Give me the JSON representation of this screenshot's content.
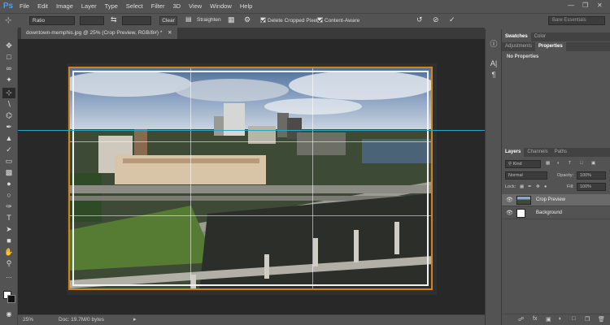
{
  "app": {
    "logo": "Ps",
    "menu": [
      "File",
      "Edit",
      "Image",
      "Layer",
      "Type",
      "Select",
      "Filter",
      "3D",
      "View",
      "Window",
      "Help"
    ]
  },
  "options_bar": {
    "ratio_select": "Ratio",
    "clear_label": "Clear",
    "straighten_label": "Straighten",
    "delete_cropped_label": "Delete Cropped Pixels",
    "content_aware_label": "Content-Aware",
    "workspace": "Bare Essentials"
  },
  "document": {
    "tab_title": "downtown-memphis.jpg @ 25% (Crop Preview, RGB/8#) *"
  },
  "status": {
    "zoom": "25%",
    "doc_size": "Doc: 19.7M/0 bytes"
  },
  "panels": {
    "top_tabs": [
      "Swatches",
      "Color"
    ],
    "mid_tabs": [
      "Adjustments",
      "Properties"
    ],
    "properties_text": "No Properties",
    "layer_tabs": [
      "Layers",
      "Channels",
      "Paths"
    ],
    "kind_filter": "Kind",
    "blend_mode": "Normal",
    "opacity_label": "Opacity:",
    "opacity_value": "100%",
    "lock_label": "Lock:",
    "fill_label": "Fill:",
    "fill_value": "100%",
    "layers": [
      {
        "name": "Crop Preview",
        "selected": true
      },
      {
        "name": "Background",
        "selected": false
      }
    ]
  },
  "colors": {
    "crop_border": "#d4821a",
    "guide": "#25a8c8",
    "ps_blue": "#31a8ff"
  }
}
